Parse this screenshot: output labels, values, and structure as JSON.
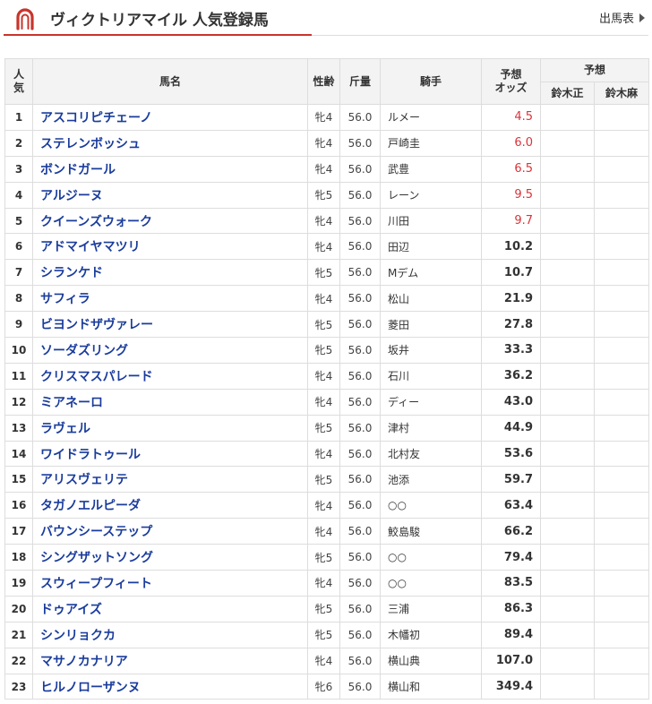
{
  "header": {
    "title": "ヴィクトリアマイル 人気登録馬",
    "entry_link": "出馬表"
  },
  "table": {
    "headers": {
      "rank_line1": "人",
      "rank_line2": "気",
      "name": "馬名",
      "sex_age": "性齢",
      "weight": "斤量",
      "jockey": "騎手",
      "odds_line1": "予想",
      "odds_line2": "オッズ",
      "prediction": "予想",
      "predictor1": "鈴木正",
      "predictor2": "鈴木麻"
    },
    "rows": [
      {
        "rank": "1",
        "name": "アスコリピチェーノ",
        "sex_age": "牝4",
        "weight": "56.0",
        "jockey": "ルメー",
        "odds": "4.5",
        "fav": true
      },
      {
        "rank": "2",
        "name": "ステレンボッシュ",
        "sex_age": "牝4",
        "weight": "56.0",
        "jockey": "戸崎圭",
        "odds": "6.0",
        "fav": true
      },
      {
        "rank": "3",
        "name": "ボンドガール",
        "sex_age": "牝4",
        "weight": "56.0",
        "jockey": "武豊",
        "odds": "6.5",
        "fav": true
      },
      {
        "rank": "4",
        "name": "アルジーヌ",
        "sex_age": "牝5",
        "weight": "56.0",
        "jockey": "レーン",
        "odds": "9.5",
        "fav": true
      },
      {
        "rank": "5",
        "name": "クイーンズウォーク",
        "sex_age": "牝4",
        "weight": "56.0",
        "jockey": "川田",
        "odds": "9.7",
        "fav": true
      },
      {
        "rank": "6",
        "name": "アドマイヤマツリ",
        "sex_age": "牝4",
        "weight": "56.0",
        "jockey": "田辺",
        "odds": "10.2",
        "fav": false
      },
      {
        "rank": "7",
        "name": "シランケド",
        "sex_age": "牝5",
        "weight": "56.0",
        "jockey": "Mデム",
        "odds": "10.7",
        "fav": false
      },
      {
        "rank": "8",
        "name": "サフィラ",
        "sex_age": "牝4",
        "weight": "56.0",
        "jockey": "松山",
        "odds": "21.9",
        "fav": false
      },
      {
        "rank": "9",
        "name": "ビヨンドザヴァレー",
        "sex_age": "牝5",
        "weight": "56.0",
        "jockey": "菱田",
        "odds": "27.8",
        "fav": false
      },
      {
        "rank": "10",
        "name": "ソーダズリング",
        "sex_age": "牝5",
        "weight": "56.0",
        "jockey": "坂井",
        "odds": "33.3",
        "fav": false
      },
      {
        "rank": "11",
        "name": "クリスマスパレード",
        "sex_age": "牝4",
        "weight": "56.0",
        "jockey": "石川",
        "odds": "36.2",
        "fav": false
      },
      {
        "rank": "12",
        "name": "ミアネーロ",
        "sex_age": "牝4",
        "weight": "56.0",
        "jockey": "ディー",
        "odds": "43.0",
        "fav": false
      },
      {
        "rank": "13",
        "name": "ラヴェル",
        "sex_age": "牝5",
        "weight": "56.0",
        "jockey": "津村",
        "odds": "44.9",
        "fav": false
      },
      {
        "rank": "14",
        "name": "ワイドラトゥール",
        "sex_age": "牝4",
        "weight": "56.0",
        "jockey": "北村友",
        "odds": "53.6",
        "fav": false
      },
      {
        "rank": "15",
        "name": "アリスヴェリテ",
        "sex_age": "牝5",
        "weight": "56.0",
        "jockey": "池添",
        "odds": "59.7",
        "fav": false
      },
      {
        "rank": "16",
        "name": "タガノエルピーダ",
        "sex_age": "牝4",
        "weight": "56.0",
        "jockey": "○○",
        "odds": "63.4",
        "fav": false
      },
      {
        "rank": "17",
        "name": "バウンシーステップ",
        "sex_age": "牝4",
        "weight": "56.0",
        "jockey": "鮫島駿",
        "odds": "66.2",
        "fav": false
      },
      {
        "rank": "18",
        "name": "シングザットソング",
        "sex_age": "牝5",
        "weight": "56.0",
        "jockey": "○○",
        "odds": "79.4",
        "fav": false
      },
      {
        "rank": "19",
        "name": "スウィープフィート",
        "sex_age": "牝4",
        "weight": "56.0",
        "jockey": "○○",
        "odds": "83.5",
        "fav": false
      },
      {
        "rank": "20",
        "name": "ドゥアイズ",
        "sex_age": "牝5",
        "weight": "56.0",
        "jockey": "三浦",
        "odds": "86.3",
        "fav": false
      },
      {
        "rank": "21",
        "name": "シンリョクカ",
        "sex_age": "牝5",
        "weight": "56.0",
        "jockey": "木幡初",
        "odds": "89.4",
        "fav": false
      },
      {
        "rank": "22",
        "name": "マサノカナリア",
        "sex_age": "牝4",
        "weight": "56.0",
        "jockey": "横山典",
        "odds": "107.0",
        "fav": false
      },
      {
        "rank": "23",
        "name": "ヒルノローザンヌ",
        "sex_age": "牝6",
        "weight": "56.0",
        "jockey": "横山和",
        "odds": "349.4",
        "fav": false
      }
    ]
  },
  "colors": {
    "accent": "#c8352c",
    "link": "#1a3c9c",
    "favorite_odds": "#d9343a",
    "header_bg": "#f3f3f3"
  },
  "icons": {
    "title_icon": "horseshoe-icon",
    "entry_link_icon": "triangle-right-icon"
  }
}
